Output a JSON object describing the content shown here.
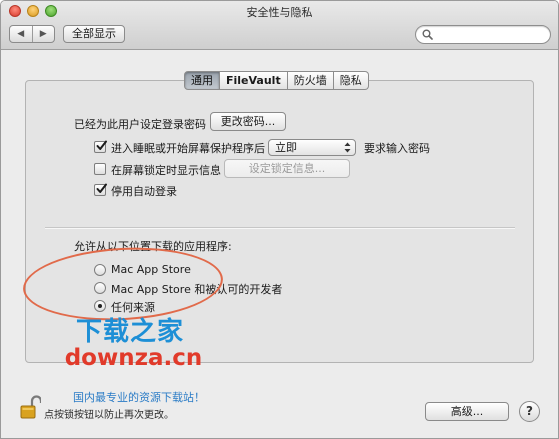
{
  "window": {
    "title": "安全性与隐私"
  },
  "toolbar": {
    "back_icon": "◀",
    "forward_icon": "▶",
    "show_all_label": "全部显示",
    "search_placeholder": "",
    "search_value": ""
  },
  "tabs": [
    {
      "label": "通用",
      "selected": true
    },
    {
      "label": "FileVault",
      "selected": false
    },
    {
      "label": "防火墙",
      "selected": false
    },
    {
      "label": "隐私",
      "selected": false
    }
  ],
  "general": {
    "password_label": "已经为此用户设定登录密码",
    "change_password_button": "更改密码...",
    "require_password": {
      "checked": true,
      "label_before": "进入睡眠或开始屏幕保护程序后",
      "select_value": "立即",
      "label_after": "要求输入密码"
    },
    "lock_message": {
      "checked": false,
      "label": "在屏幕锁定时显示信息",
      "button": "设定锁定信息..."
    },
    "disable_autologin": {
      "checked": true,
      "label": "停用自动登录"
    }
  },
  "downloads": {
    "heading": "允许从以下位置下载的应用程序:",
    "options": [
      {
        "label": "Mac App Store",
        "selected": false
      },
      {
        "label": "Mac App Store 和被认可的开发者",
        "selected": false
      },
      {
        "label": "任何来源",
        "selected": true
      }
    ]
  },
  "watermark": {
    "title": "下载之家",
    "domain": "downza.cn",
    "tagline": "国内最专业的资源下载站！"
  },
  "footer": {
    "lock_text": "点按锁按钮以防止再次更改。",
    "advanced_button": "高级...",
    "help_label": "?"
  },
  "colors": {
    "annotation_oval": "#e16a4a",
    "watermark_blue": "#1d8fd6",
    "watermark_red": "#e13a2a",
    "lock_gold": "#d9a21f"
  }
}
